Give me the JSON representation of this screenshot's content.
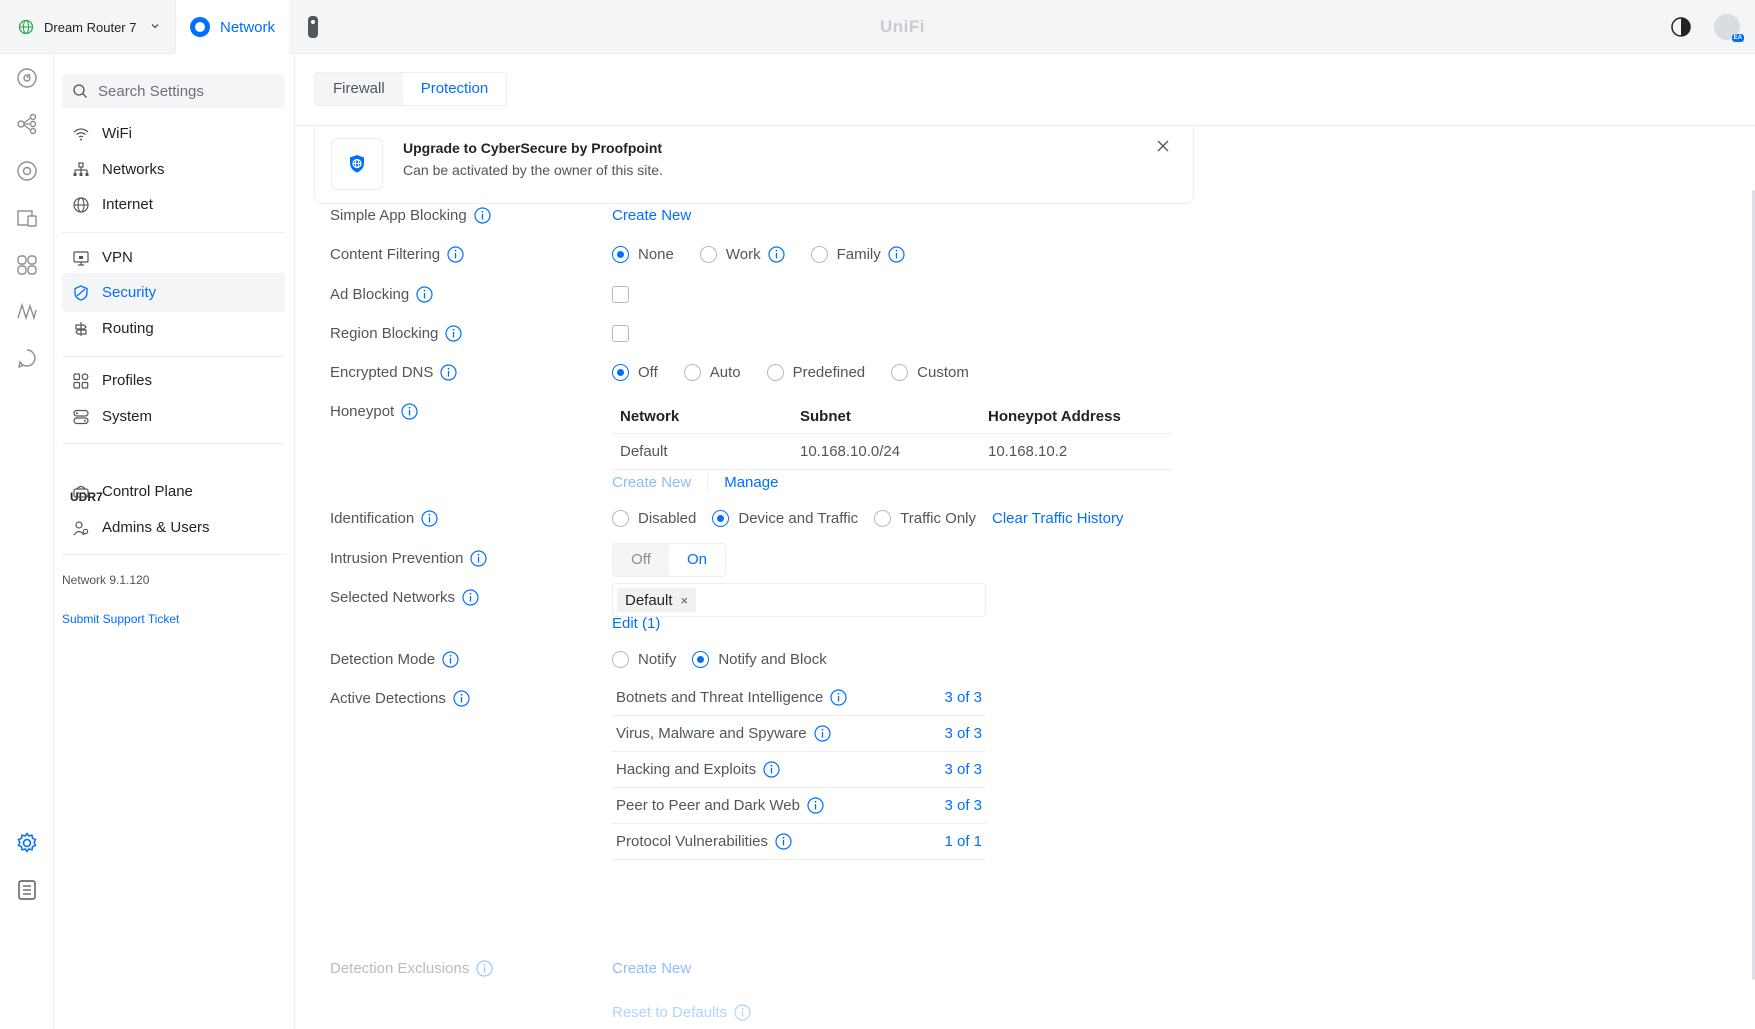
{
  "topbar": {
    "site_name": "Dream Router 7",
    "app_tab": "Network",
    "brand": "UniFi",
    "avatar_badge": "EA"
  },
  "sidebar": {
    "search_placeholder": "Search Settings",
    "items": [
      {
        "label": "WiFi",
        "icon": "wifi-icon"
      },
      {
        "label": "Networks",
        "icon": "networks-icon"
      },
      {
        "label": "Internet",
        "icon": "globe-icon"
      },
      {
        "label": "VPN",
        "icon": "vpn-icon"
      },
      {
        "label": "Security",
        "icon": "shield-icon",
        "active": true
      },
      {
        "label": "Routing",
        "icon": "routing-icon"
      },
      {
        "label": "Profiles",
        "icon": "profiles-icon"
      },
      {
        "label": "System",
        "icon": "system-icon"
      }
    ],
    "section_title": "UDR7",
    "section_items": [
      {
        "label": "Control Plane",
        "icon": "control-plane-icon"
      },
      {
        "label": "Admins & Users",
        "icon": "admins-icon"
      }
    ],
    "version": "Network 9.1.120",
    "support_link": "Submit Support Ticket"
  },
  "tabs": [
    {
      "label": "Firewall",
      "active": false
    },
    {
      "label": "Protection",
      "active": true
    }
  ],
  "banner": {
    "title": "Upgrade to CyberSecure by Proofpoint",
    "subtitle": "Can be activated by the owner of this site."
  },
  "settings": {
    "simple_app_blocking": {
      "label": "Simple App Blocking",
      "action": "Create New"
    },
    "content_filtering": {
      "label": "Content Filtering",
      "options": [
        "None",
        "Work",
        "Family"
      ],
      "selected": "None"
    },
    "ad_blocking": {
      "label": "Ad Blocking",
      "checked": false
    },
    "region_blocking": {
      "label": "Region Blocking",
      "checked": false
    },
    "encrypted_dns": {
      "label": "Encrypted DNS",
      "options": [
        "Off",
        "Auto",
        "Predefined",
        "Custom"
      ],
      "selected": "Off"
    },
    "honeypot": {
      "label": "Honeypot",
      "columns": [
        "Network",
        "Subnet",
        "Honeypot Address"
      ],
      "rows": [
        [
          "Default",
          "10.168.10.0/24",
          "10.168.10.2"
        ]
      ],
      "create_new": "Create New",
      "manage": "Manage"
    },
    "identification": {
      "label": "Identification",
      "options": [
        "Disabled",
        "Device and Traffic",
        "Traffic Only"
      ],
      "selected": "Device and Traffic",
      "clear_link": "Clear Traffic History"
    },
    "intrusion_prevention": {
      "label": "Intrusion Prevention",
      "off": "Off",
      "on": "On",
      "selected": "On"
    },
    "selected_networks": {
      "label": "Selected Networks",
      "chip": "Default",
      "chip_remove": "×",
      "edit": "Edit (1)"
    },
    "detection_mode": {
      "label": "Detection Mode",
      "options": [
        "Notify",
        "Notify and Block"
      ],
      "selected": "Notify and Block"
    },
    "active_detections": {
      "label": "Active Detections",
      "rows": [
        {
          "name": "Botnets and Threat Intelligence",
          "count": "3 of 3"
        },
        {
          "name": "Virus, Malware and Spyware",
          "count": "3 of 3"
        },
        {
          "name": "Hacking and Exploits",
          "count": "3 of 3"
        },
        {
          "name": "Peer to Peer and Dark Web",
          "count": "3 of 3"
        },
        {
          "name": "Protocol Vulnerabilities",
          "count": "1 of 1"
        }
      ]
    },
    "detection_exclusions": {
      "label": "Detection Exclusions",
      "action": "Create New"
    },
    "reset": {
      "label": "Reset to Defaults"
    }
  },
  "colors": {
    "accent": "#006fff",
    "text": "#50565e",
    "border": "#eceef0"
  }
}
